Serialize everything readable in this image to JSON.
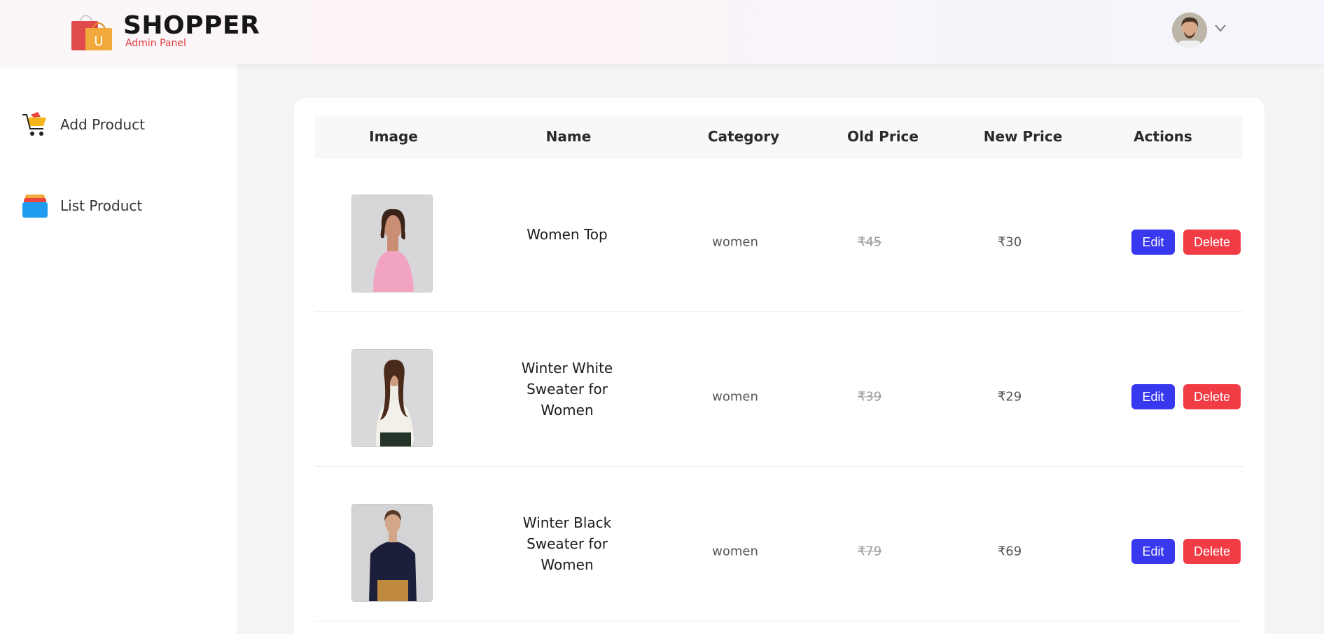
{
  "header": {
    "brand": "SHOPPER",
    "subtitle": "Admin Panel",
    "logo_icon": "shopping-bag-icon",
    "avatar_icon": "user-avatar",
    "menu_icon": "chevron-down-icon"
  },
  "sidebar": {
    "items": [
      {
        "label": "Add Product",
        "icon": "cart-icon"
      },
      {
        "label": "List Product",
        "icon": "stacked-list-icon"
      }
    ]
  },
  "table": {
    "headers": [
      "Image",
      "Name",
      "Category",
      "Old Price",
      "New Price",
      "Actions"
    ],
    "rows": [
      {
        "name": "Women Top",
        "category": "women",
        "old_price": "₹45",
        "new_price": "₹30",
        "edit": "Edit",
        "delete": "Delete"
      },
      {
        "name": "Winter White Sweater for Women",
        "category": "women",
        "old_price": "₹39",
        "new_price": "₹29",
        "edit": "Edit",
        "delete": "Delete"
      },
      {
        "name": "Winter Black Sweater for Women",
        "category": "women",
        "old_price": "₹79",
        "new_price": "₹69",
        "edit": "Edit",
        "delete": "Delete"
      }
    ]
  },
  "colors": {
    "edit_button": "#3838ee",
    "delete_button": "#f23c45",
    "brand_subtitle": "#e23b3b"
  }
}
